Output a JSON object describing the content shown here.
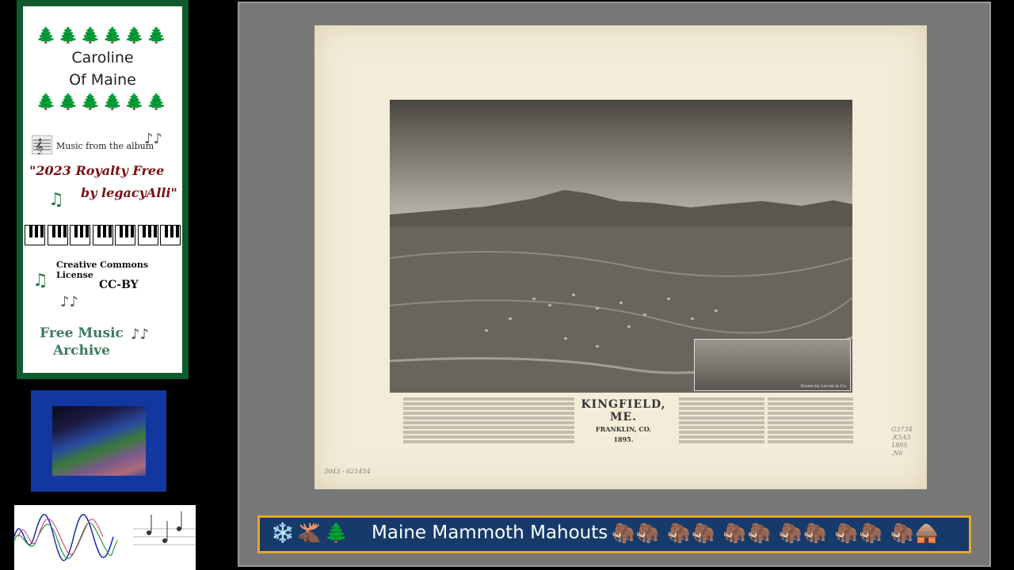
{
  "card": {
    "trees": "🌲🌲🌲🌲🌲🌲",
    "artist_line1": "Caroline",
    "artist_line2": "Of Maine",
    "music_from": "Music from the album",
    "album_line1": "\"2023 Royalty Free",
    "album_line2": "by legacyAlli\"",
    "license_title": "Creative Commons License",
    "license_code": "CC-BY",
    "archive_line1": "Free Music",
    "archive_line2": "Archive",
    "note_single": "♫",
    "note_double": "♪♪"
  },
  "map": {
    "title": "KINGFIELD, ME.",
    "county": "FRANKLIN, CO.",
    "year": "1895.",
    "catalog_left": "3043 - 621454",
    "catalog_right": "G3734 .K5A3 1895 .N6",
    "inset_caption": "Drawn by Lavoie & Co."
  },
  "bar": {
    "icons": "❄️🫎🌲",
    "title": "Maine Mammoth Mahouts",
    "mammoths": "🦣🦣 🦣🦣 🦣🦣 🦣🦣 🦣🦣   🦣🛖",
    "colors": {
      "background": "#163a6a",
      "border": "#e0a92a"
    }
  }
}
